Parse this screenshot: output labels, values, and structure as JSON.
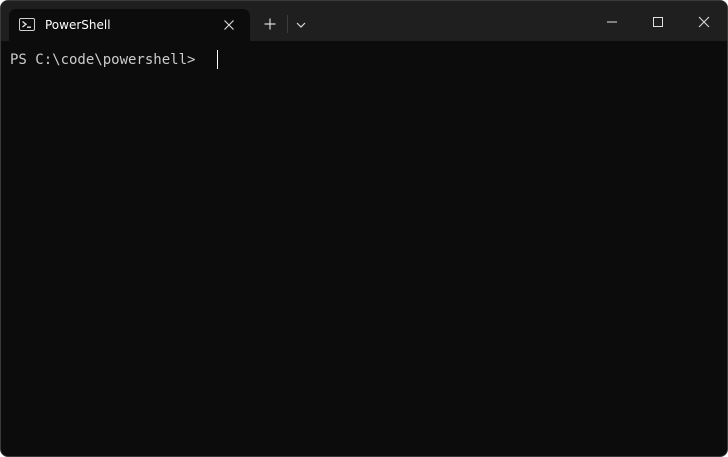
{
  "tabs": [
    {
      "title": "PowerShell",
      "icon": "powershell-icon",
      "active": true
    }
  ],
  "terminal": {
    "prompt": "PS C:\\code\\powershell>"
  },
  "colors": {
    "titlebar": "#1f1f1f",
    "terminal_background": "#0c0c0c",
    "text": "#cccccc"
  }
}
